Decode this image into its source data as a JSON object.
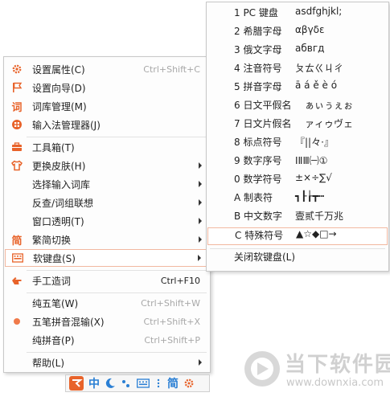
{
  "main_menu": {
    "items": [
      {
        "label": "设置属性(C)",
        "shortcut": "Ctrl+Shift+C",
        "icon": "gear-icon"
      },
      {
        "label": "设置向导(D)",
        "shortcut": "",
        "icon": "flag-icon"
      },
      {
        "label": "词库管理(M)",
        "shortcut": "",
        "icon": "dictionary-icon"
      },
      {
        "label": "输入法管理器(J)",
        "shortcut": "",
        "icon": "manager-icon"
      },
      {
        "label": "工具箱(T)",
        "shortcut": "",
        "icon": "toolbox-icon"
      },
      {
        "label": "更换皮肤(H)",
        "shortcut": "",
        "icon": "shirt-icon"
      },
      {
        "label": "选择输入词库",
        "shortcut": "",
        "icon": ""
      },
      {
        "label": "反查/词组联想",
        "shortcut": "",
        "icon": ""
      },
      {
        "label": "窗口透明(T)",
        "shortcut": "",
        "icon": ""
      },
      {
        "label": "繁简切换",
        "shortcut": "",
        "icon": "traditional-simplified-icon"
      },
      {
        "label": "软键盘(S)",
        "shortcut": "",
        "icon": "keyboard-icon"
      },
      {
        "label": "手工造词",
        "shortcut": "Ctrl+F10",
        "icon": "hand-icon"
      },
      {
        "label": "纯五笔(W)",
        "shortcut": "Ctrl+Shift+W",
        "icon": ""
      },
      {
        "label": "五笔拼音混输(X)",
        "shortcut": "Ctrl+Shift+X",
        "icon": "dot-icon"
      },
      {
        "label": "纯拼音(P)",
        "shortcut": "Ctrl+Shift+P",
        "icon": ""
      },
      {
        "label": "帮助(L)",
        "shortcut": "",
        "icon": ""
      }
    ]
  },
  "soft_keyboard_menu": {
    "items": [
      {
        "label": "1 PC 键盘",
        "sample": "asdfghjkl;"
      },
      {
        "label": "2 希腊字母",
        "sample": "αβγδε"
      },
      {
        "label": "3 俄文字母",
        "sample": "абвгд"
      },
      {
        "label": "4 注音符号",
        "sample": "ㄆㄊㄍㄐㄔ"
      },
      {
        "label": "5 拼音字母",
        "sample": "ā á ě è ó"
      },
      {
        "label": "6 日文平假名",
        "sample": "ぁぃぅぇぉ"
      },
      {
        "label": "7 日文片假名",
        "sample": "ァィゥヴェ"
      },
      {
        "label": "8 标点符号",
        "sample": "『||々·』"
      },
      {
        "label": "9 数字序号",
        "sample": "ⅠⅡⅢ㈠①"
      },
      {
        "label": "0 数学符号",
        "sample": "±×÷∑√"
      },
      {
        "label": "A 制表符",
        "sample": "┓┠┟┳┅"
      },
      {
        "label": "B 中文数字",
        "sample": "壹贰千万兆"
      },
      {
        "label": "C 特殊符号",
        "sample": "▲☆◆□→"
      }
    ],
    "close_label": "关闭软键盘(L)"
  },
  "taskbar": {
    "items": [
      "中",
      "简"
    ]
  },
  "watermark": {
    "title": "当下软件园",
    "url": "www.downxia.com"
  },
  "colors": {
    "accent": "#f07030",
    "highlight_border": "#f2b8a0",
    "icon_orange": "#e8632a",
    "taskbar_blue": "#2a7fd4"
  }
}
